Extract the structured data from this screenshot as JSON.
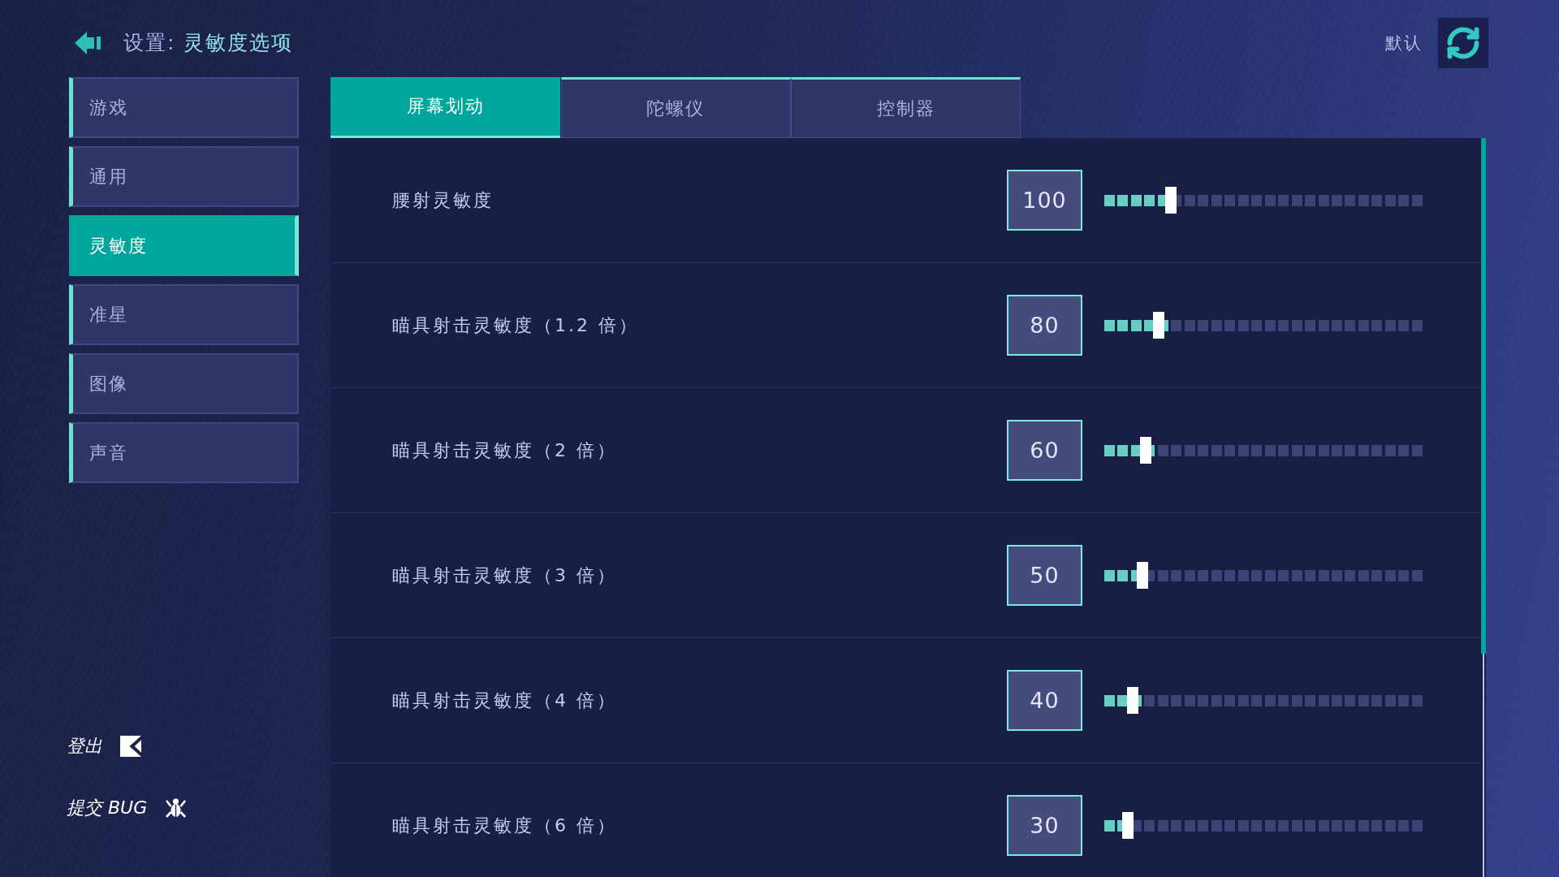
{
  "header": {
    "section": "设置:",
    "page": "灵敏度选项",
    "default_label": "默认"
  },
  "sidebar": {
    "items": [
      {
        "label": "游戏",
        "selected": false
      },
      {
        "label": "通用",
        "selected": false
      },
      {
        "label": "灵敏度",
        "selected": true
      },
      {
        "label": "准星",
        "selected": false
      },
      {
        "label": "图像",
        "selected": false
      },
      {
        "label": "声音",
        "selected": false
      }
    ],
    "actions": [
      {
        "label": "登出",
        "kind": "logout"
      },
      {
        "label": "提交 BUG",
        "kind": "bug_report"
      }
    ]
  },
  "tabs": [
    {
      "label": "屏幕划动",
      "selected": true
    },
    {
      "label": "陀螺仪",
      "selected": false
    },
    {
      "label": "控制器",
      "selected": false
    }
  ],
  "settings": [
    {
      "label": "腰射灵敏度",
      "value": "100",
      "level": 0.21
    },
    {
      "label": "瞄具射击灵敏度（1.2 倍）",
      "value": "80",
      "level": 0.17
    },
    {
      "label": "瞄具射击灵敏度（2 倍）",
      "value": "60",
      "level": 0.13
    },
    {
      "label": "瞄具射击灵敏度（3 倍）",
      "value": "50",
      "level": 0.12
    },
    {
      "label": "瞄具射击灵敏度（4 倍）",
      "value": "40",
      "level": 0.09
    },
    {
      "label": "瞄具射击灵敏度（6 倍）",
      "value": "30",
      "level": 0.075
    }
  ]
}
